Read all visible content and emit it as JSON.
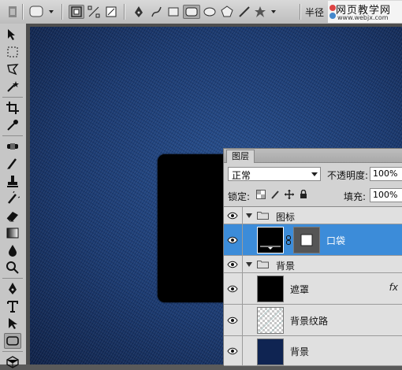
{
  "options_bar": {
    "radius_label": "半径",
    "icons": [
      "tool-preset-icon",
      "shape-layers-icon",
      "paths-icon",
      "fill-pixels-icon",
      "pen-tool-icon",
      "freeform-pen-icon",
      "rectangle-icon",
      "rounded-rectangle-icon",
      "ellipse-icon",
      "polygon-icon",
      "line-icon",
      "custom-shape-icon"
    ]
  },
  "watermark": {
    "title": "网页教学网",
    "url": "www.webjx.com"
  },
  "layers_panel": {
    "tab_label": "图层",
    "blend_mode": "正常",
    "opacity_label": "不透明度:",
    "opacity_value": "100%",
    "lock_label": "锁定:",
    "fill_label": "填充:",
    "fill_value": "100%",
    "layers": [
      {
        "name": "图标",
        "kind": "group",
        "selected": false
      },
      {
        "name": "口袋",
        "kind": "shape",
        "selected": true
      },
      {
        "name": "背景",
        "kind": "group",
        "selected": false
      },
      {
        "name": "遮罩",
        "kind": "layer",
        "selected": false,
        "fx": "fx"
      },
      {
        "name": "背景纹路",
        "kind": "layer",
        "selected": false
      },
      {
        "name": "背景",
        "kind": "layer",
        "selected": false
      }
    ]
  },
  "colors": {
    "canvas": "#1a3566",
    "selection": "#3c8cd9",
    "pocket": "#000000"
  }
}
